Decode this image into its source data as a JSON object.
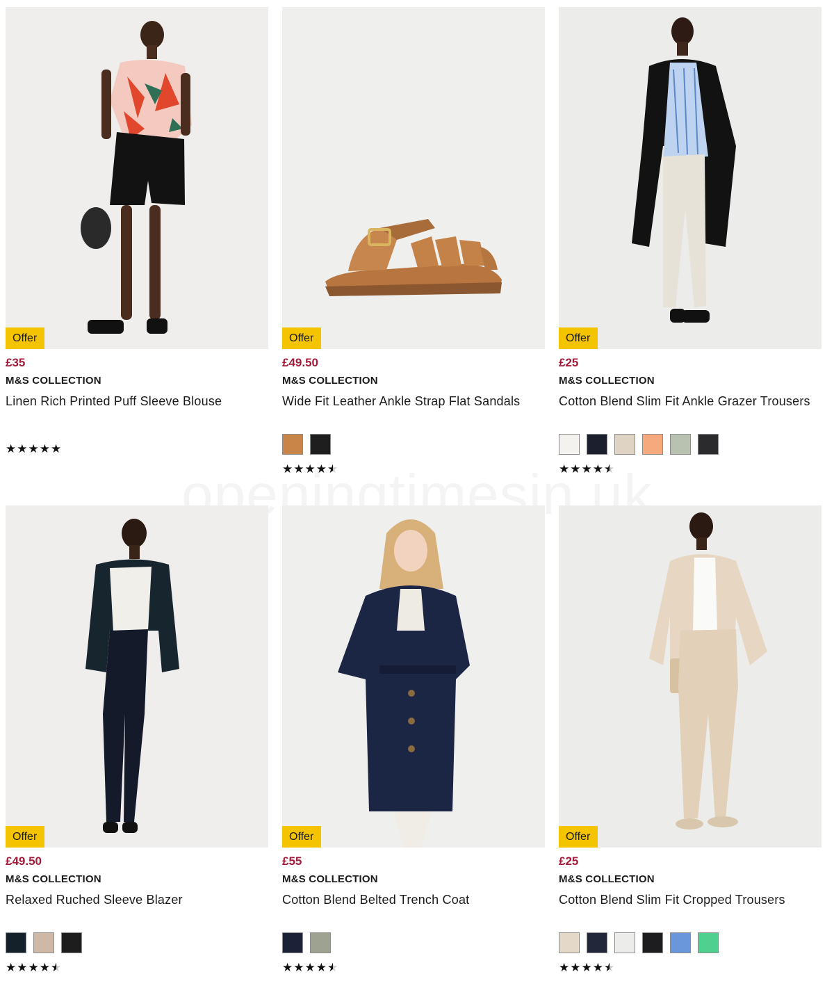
{
  "watermark": "openingtimesin.uk",
  "colors": {
    "price": "#a21c3a",
    "offer_badge": "#f5c400"
  },
  "products": [
    {
      "image": "model wearing floral blouse and black shorts",
      "offer": "Offer",
      "price": "£35",
      "brand": "M&S COLLECTION",
      "name": "Linen Rich Printed Puff Sleeve Blouse",
      "swatches": [],
      "rating": 5
    },
    {
      "image": "tan leather fisherman sandal",
      "offer": "Offer",
      "price": "£49.50",
      "brand": "M&S COLLECTION",
      "name": "Wide Fit Leather Ankle Strap Flat Sandals",
      "swatches": [
        "#c98548",
        "#1e1e1e"
      ],
      "rating": 4.5
    },
    {
      "image": "model wearing black coat, striped shirt and cream trousers",
      "offer": "Offer",
      "price": "£25",
      "brand": "M&S COLLECTION",
      "name": "Cotton Blend Slim Fit Ankle Grazer Trousers",
      "swatches": [
        "#f3f2ee",
        "#1c1f2e",
        "#dfd3c3",
        "#f5a97d",
        "#b9c2b1",
        "#2b2b2d"
      ],
      "rating": 4.5
    },
    {
      "image": "model wearing navy blazer, white tee and dark jeans",
      "offer": "Offer",
      "price": "£49.50",
      "brand": "M&S COLLECTION",
      "name": "Relaxed Ruched Sleeve Blazer",
      "swatches": [
        "#14202a",
        "#cdb9a6",
        "#1d1d1d"
      ],
      "rating": 4.8
    },
    {
      "image": "model wearing navy belted trench coat",
      "offer": "Offer",
      "price": "£55",
      "brand": "M&S COLLECTION",
      "name": "Cotton Blend Belted Trench Coat",
      "swatches": [
        "#1b2238",
        "#9ea391"
      ],
      "rating": 4.5
    },
    {
      "image": "model wearing beige trench jacket and cropped trousers",
      "offer": "Offer",
      "price": "£25",
      "brand": "M&S COLLECTION",
      "name": "Cotton Blend Slim Fit Cropped Trousers",
      "swatches": [
        "#e4d8c8",
        "#23273a",
        "#ececea",
        "#1d1d1f",
        "#6a96dc",
        "#4fd08f"
      ],
      "rating": 4.5
    }
  ]
}
